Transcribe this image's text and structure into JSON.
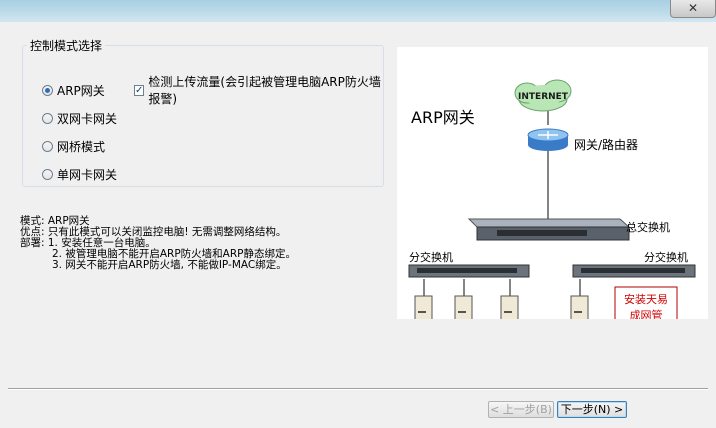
{
  "window": {
    "close_glyph": "✕"
  },
  "mode_group": {
    "title": "控制模式选择",
    "options": [
      {
        "label": "ARP网关",
        "checked": true
      },
      {
        "label": "双网卡网关",
        "checked": false
      },
      {
        "label": "网桥模式",
        "checked": false
      },
      {
        "label": "单网卡网关",
        "checked": false
      }
    ],
    "detect_checkbox": {
      "label": "检测上传流量(会引起被管理电脑ARP防火墙报警)",
      "checked": true
    }
  },
  "description": {
    "line1": "模式: ARP网关",
    "line2": "优点: 只有此模式可以关闭监控电脑! 无需调整网络结构。",
    "line3": "部署: 1. 安装任意一台电脑。",
    "line4": "2. 被管理电脑不能开启ARP防火墙和ARP静态绑定。",
    "line5": "3. 网关不能开启ARP防火墙, 不能做IP-MAC绑定。"
  },
  "diagram": {
    "title": "ARP网关",
    "internet": "INTERNET",
    "router_label": "网关/路由器",
    "core_switch_label": "总交换机",
    "left_switch_label": "分交换机",
    "right_switch_label": "分交换机",
    "install_note_line1": "安装天易",
    "install_note_line2": "成网管"
  },
  "buttons": {
    "prev": "< 上一步(B)",
    "next": "下一步(N) >"
  },
  "colors": {
    "accent": "#2c6fb3",
    "note_red": "#d00000",
    "link_line": "#333333"
  }
}
